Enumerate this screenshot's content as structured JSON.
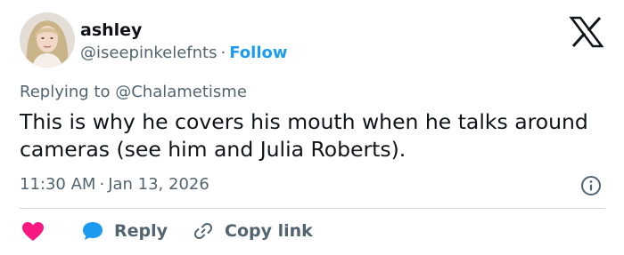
{
  "author": {
    "name": "ashley",
    "handle": "@iseepinkelefnts",
    "separator": "·",
    "follow_label": "Follow"
  },
  "reply_context": {
    "prefix": "Replying to",
    "mention": "@Chalametisme"
  },
  "tweet": {
    "text": "This is why he covers his mouth when he talks around cameras (see him and Julia Roberts).",
    "time": "11:30 AM",
    "separator": "·",
    "date": "Jan 13, 2026"
  },
  "actions": {
    "reply_label": "Reply",
    "copy_link_label": "Copy link"
  },
  "icons": {
    "logo": "x-logo-icon",
    "info": "info-icon",
    "like": "heart-icon",
    "reply": "speech-bubble-icon",
    "copy": "link-icon"
  },
  "colors": {
    "text": "#0f1419",
    "secondary": "#536471",
    "accent": "#1d9bf0",
    "like": "#f91880",
    "divider": "#cfd9de"
  }
}
